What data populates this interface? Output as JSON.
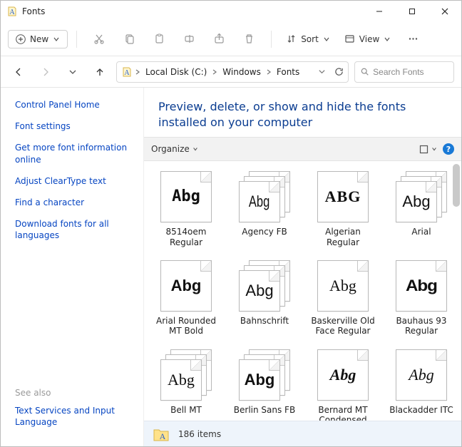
{
  "window": {
    "title": "Fonts"
  },
  "toolbar": {
    "new_label": "New",
    "sort_label": "Sort",
    "view_label": "View"
  },
  "address": {
    "crumbs": [
      "Local Disk (C:)",
      "Windows",
      "Fonts"
    ]
  },
  "search": {
    "placeholder": "Search Fonts"
  },
  "sidebar": {
    "links": [
      "Control Panel Home",
      "Font settings",
      "Get more font information online",
      "Adjust ClearType text",
      "Find a character",
      "Download fonts for all languages"
    ],
    "see_also_label": "See also",
    "see_also_links": [
      "Text Services and Input Language"
    ]
  },
  "main": {
    "heading": "Preview, delete, or show and hide the fonts installed on your computer",
    "organize_label": "Organize"
  },
  "fonts": [
    {
      "name": "8514oem Regular",
      "sample": "Abg",
      "stack": false,
      "ff": "ff-pixel"
    },
    {
      "name": "Agency FB",
      "sample": "Abg",
      "stack": true,
      "ff": "ff-agency"
    },
    {
      "name": "Algerian Regular",
      "sample": "ABG",
      "stack": false,
      "ff": "ff-algerian"
    },
    {
      "name": "Arial",
      "sample": "Abg",
      "stack": true,
      "ff": "ff-arial"
    },
    {
      "name": "Arial Rounded MT Bold",
      "sample": "Abg",
      "stack": false,
      "ff": "ff-arialrnd"
    },
    {
      "name": "Bahnschrift",
      "sample": "Abg",
      "stack": true,
      "ff": "ff-bahnschrift"
    },
    {
      "name": "Baskerville Old Face Regular",
      "sample": "Abg",
      "stack": false,
      "ff": "ff-baskerville"
    },
    {
      "name": "Bauhaus 93 Regular",
      "sample": "Abg",
      "stack": false,
      "ff": "ff-bauhaus"
    },
    {
      "name": "Bell MT",
      "sample": "Abg",
      "stack": true,
      "ff": "ff-bellmt"
    },
    {
      "name": "Berlin Sans FB",
      "sample": "Abg",
      "stack": true,
      "ff": "ff-berlin"
    },
    {
      "name": "Bernard MT Condensed",
      "sample": "Abg",
      "stack": false,
      "ff": "ff-bernard"
    },
    {
      "name": "Blackadder ITC",
      "sample": "Abg",
      "stack": false,
      "ff": "ff-blackadder"
    }
  ],
  "status": {
    "count_label": "186 items"
  }
}
